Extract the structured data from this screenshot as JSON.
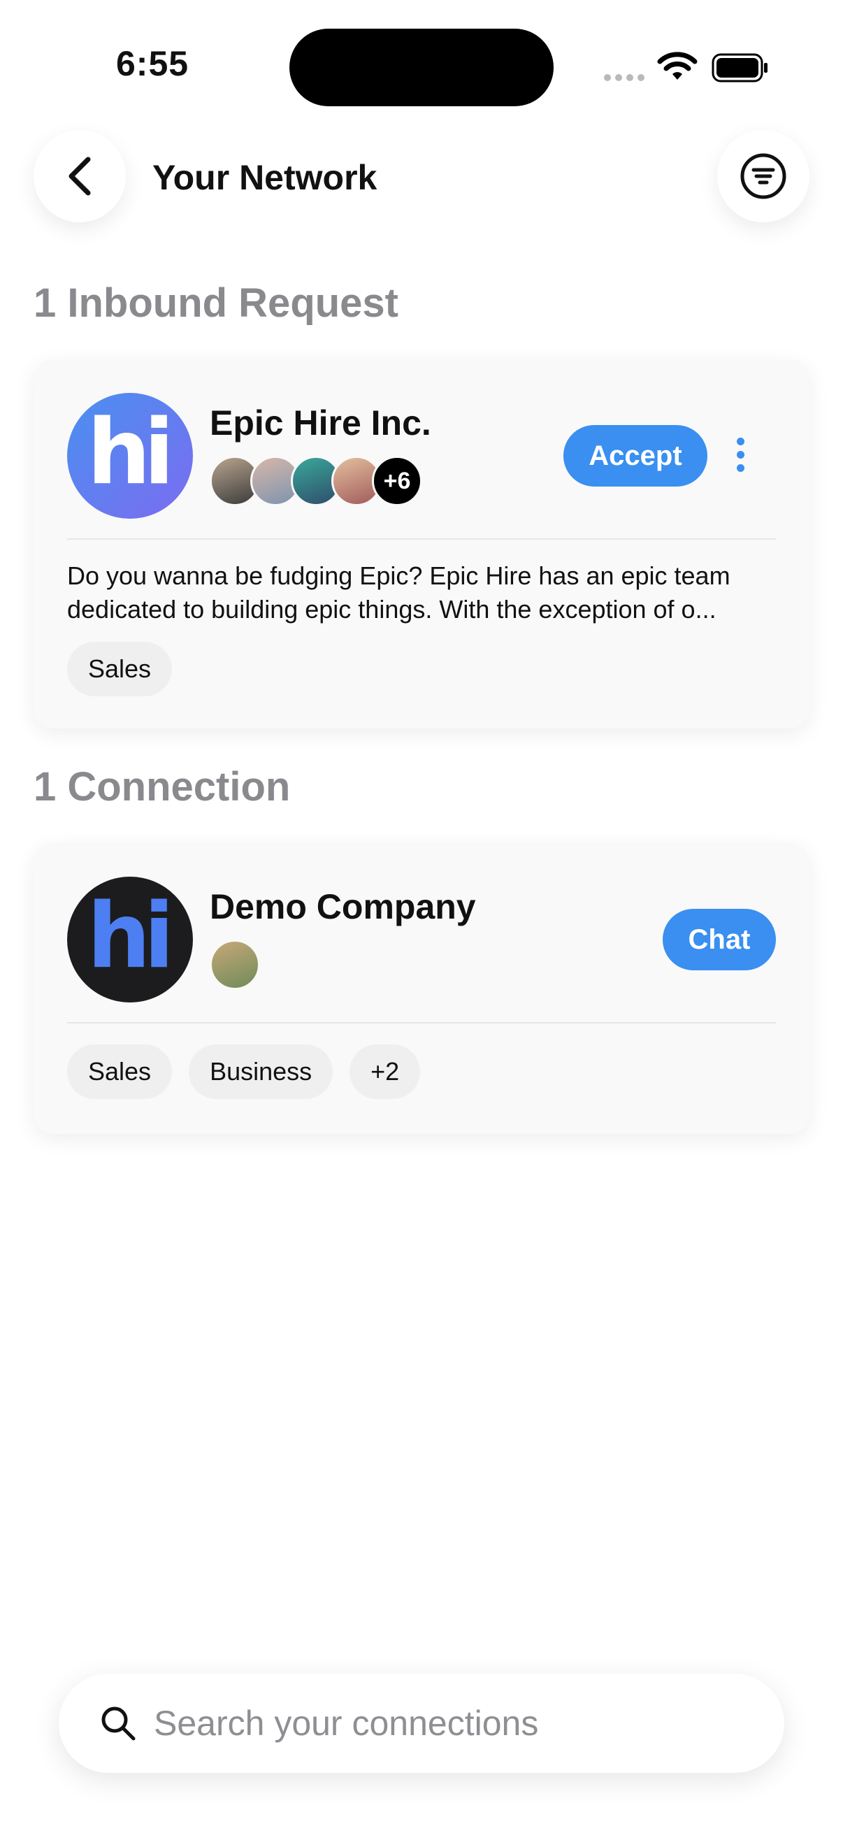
{
  "status_bar": {
    "time": "6:55"
  },
  "header": {
    "title": "Your Network"
  },
  "inbound": {
    "section_title": "1 Inbound Request",
    "company": {
      "name": "Epic Hire Inc.",
      "logo_text": "hi",
      "member_more": "+6",
      "accept_label": "Accept",
      "description": "Do you wanna be fudging Epic? Epic Hire has an epic team dedicated to building epic things. With the exception of o...",
      "tags": [
        "Sales"
      ]
    }
  },
  "connections": {
    "section_title": "1 Connection",
    "company": {
      "name": "Demo Company",
      "logo_text": "hi",
      "chat_label": "Chat",
      "tags": [
        "Sales",
        "Business",
        "+2"
      ]
    }
  },
  "search": {
    "placeholder": "Search your connections"
  },
  "colors": {
    "accent": "#3a8ff0",
    "section_title": "#8a8a8e",
    "card_bg": "#f9f9f9"
  },
  "icons": [
    "back-chevron-icon",
    "filter-icon",
    "more-vertical-icon",
    "search-icon",
    "wifi-icon",
    "battery-icon"
  ]
}
